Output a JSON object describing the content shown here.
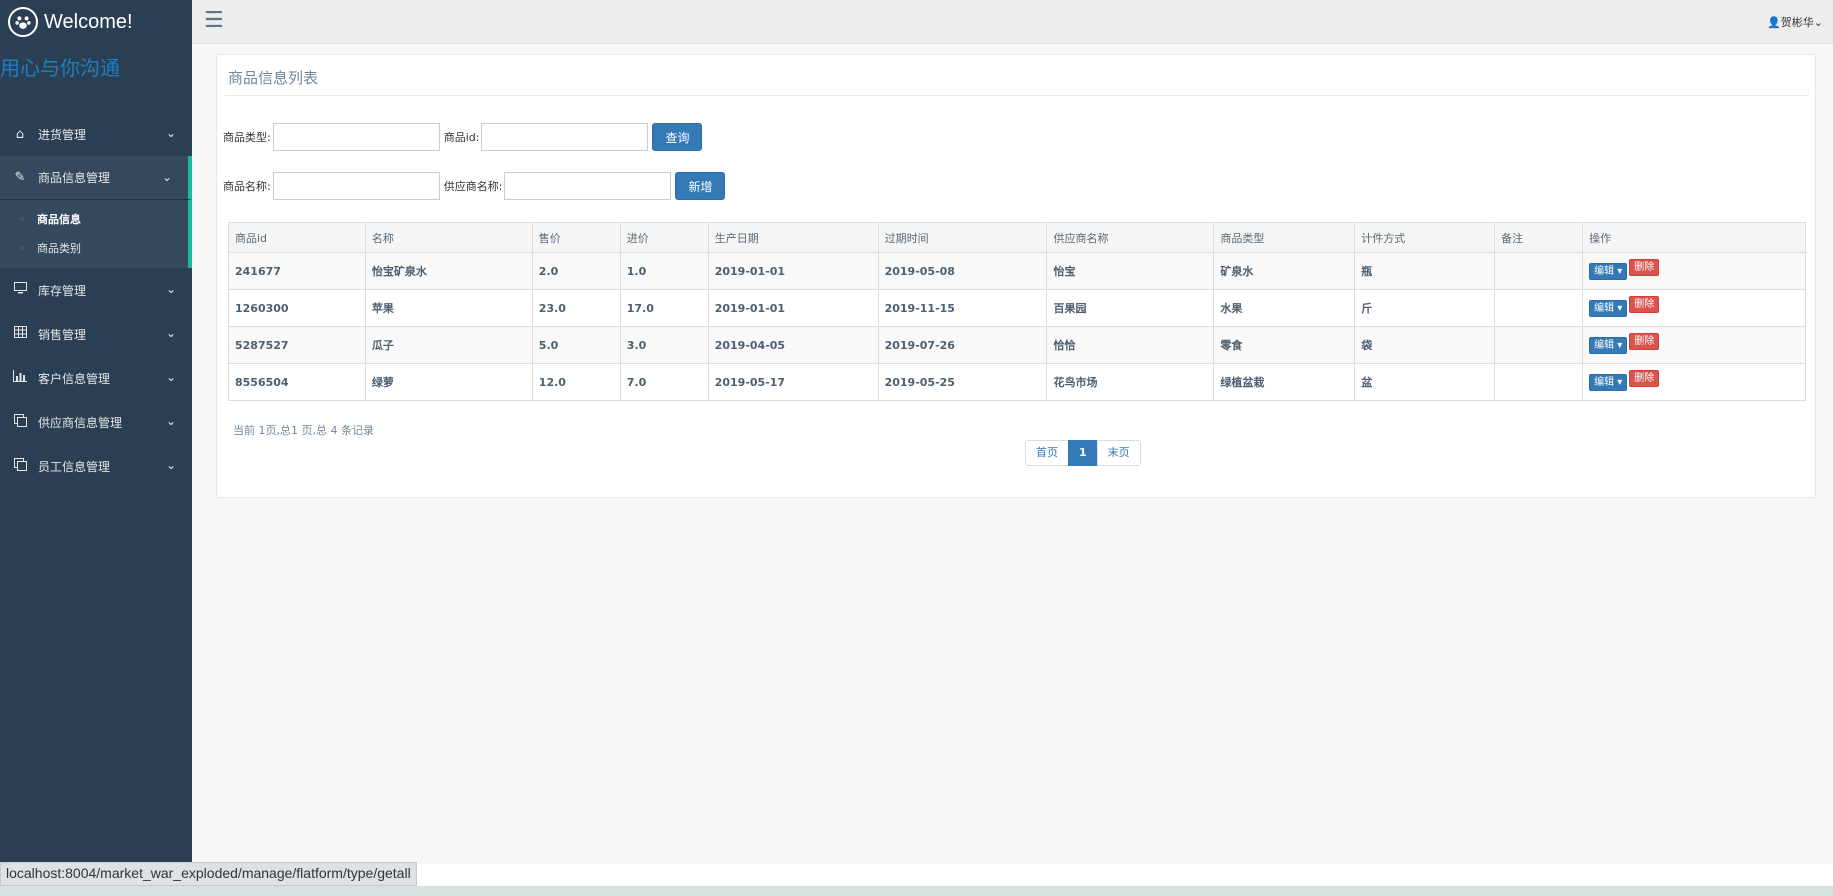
{
  "sidebar": {
    "brand_icon": "paw-icon",
    "brand_title": "Welcome!",
    "motto": "用心与你沟通",
    "nav": [
      {
        "label": "进货管理",
        "icon": "home-icon"
      },
      {
        "label": "商品信息管理",
        "icon": "edit-icon",
        "active": true
      },
      {
        "label": "库存管理",
        "icon": "desktop-icon"
      },
      {
        "label": "销售管理",
        "icon": "table-icon"
      },
      {
        "label": "客户信息管理",
        "icon": "bar-chart-icon"
      },
      {
        "label": "供应商信息管理",
        "icon": "clone-icon"
      },
      {
        "label": "员工信息管理",
        "icon": "clone-icon"
      }
    ],
    "subnav": [
      {
        "label": "商品信息"
      },
      {
        "label": "商品类别"
      }
    ]
  },
  "topbar": {
    "user_name": "贺彬华"
  },
  "panel": {
    "title": "商品信息列表",
    "form": {
      "type_label": "商品类型:",
      "id_label": "商品id:",
      "query_label": "查询",
      "name_label": "商品名称:",
      "supplier_label": "供应商名称:",
      "add_label": "新增",
      "type_value": "",
      "id_value": "",
      "name_value": "",
      "supplier_value": ""
    },
    "table": {
      "headers": [
        "商品id",
        "名称",
        "售价",
        "进价",
        "生产日期",
        "过期时间",
        "供应商名称",
        "商品类型",
        "计件方式",
        "备注",
        "操作"
      ],
      "rows": [
        [
          "241677",
          "怡宝矿泉水",
          "2.0",
          "1.0",
          "2019-01-01",
          "2019-05-08",
          "怡宝",
          "矿泉水",
          "瓶",
          ""
        ],
        [
          "1260300",
          "苹果",
          "23.0",
          "17.0",
          "2019-01-01",
          "2019-11-15",
          "百果园",
          "水果",
          "斤",
          ""
        ],
        [
          "5287527",
          "瓜子",
          "5.0",
          "3.0",
          "2019-04-05",
          "2019-07-26",
          "恰恰",
          "零食",
          "袋",
          ""
        ],
        [
          "8556504",
          "绿萝",
          "12.0",
          "7.0",
          "2019-05-17",
          "2019-05-25",
          "花鸟市场",
          "绿植盆栽",
          "盆",
          ""
        ]
      ],
      "edit_label": "编辑",
      "delete_label": "删除"
    },
    "records": "当前 1页,总1 页,总 4 条记录",
    "pager": {
      "first": "首页",
      "current": "1",
      "last": "末页"
    }
  },
  "status_url": "localhost:8004/market_war_exploded/manage/flatform/type/getall",
  "colors": {
    "sidebar_bg": "#2a3f54",
    "accent": "#1abb9c",
    "primary": "#337ab7",
    "danger": "#d9534f"
  }
}
